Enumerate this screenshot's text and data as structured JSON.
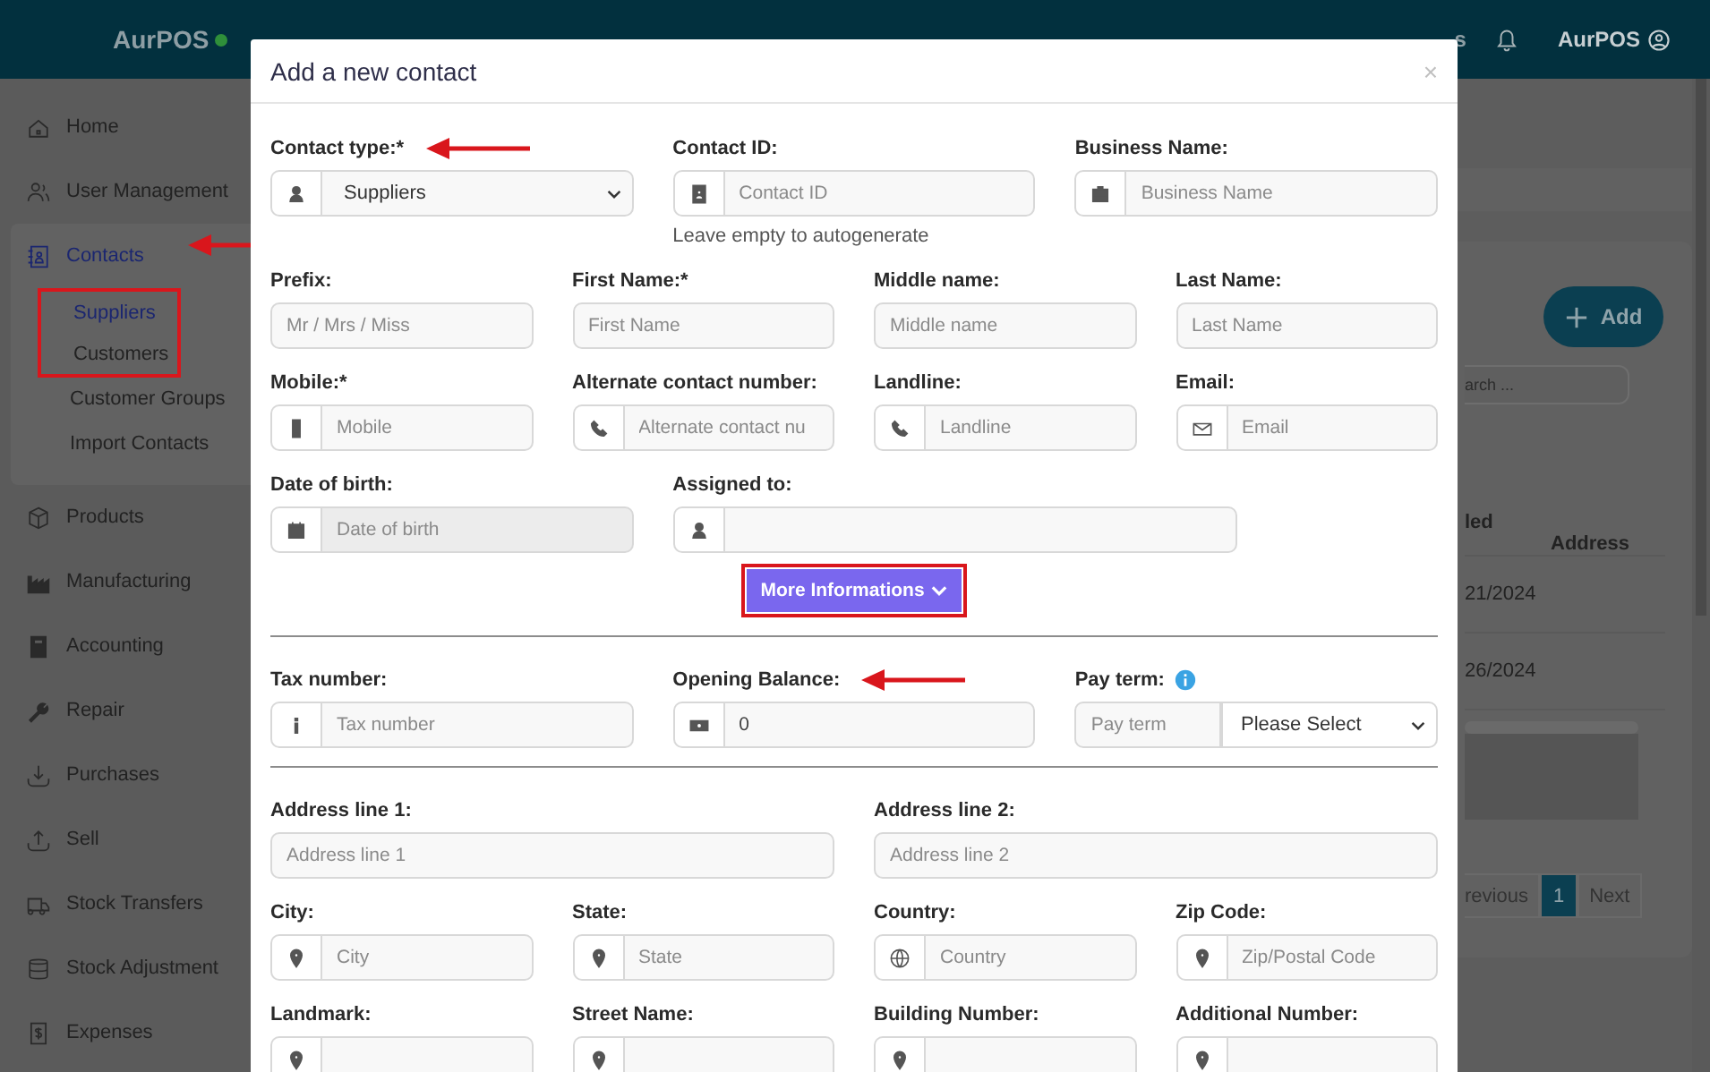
{
  "header": {
    "brand": "AurPOS",
    "fragment": "s",
    "user": "AurPOS"
  },
  "sidebar": {
    "items": [
      {
        "label": "Home",
        "selected": false,
        "annotated": false
      },
      {
        "label": "User Management",
        "selected": false,
        "annotated": false
      },
      {
        "label": "Contacts",
        "selected": true,
        "annotated": true,
        "expanded": true,
        "children": [
          {
            "label": "Suppliers",
            "selected": true,
            "boxed": true
          },
          {
            "label": "Customers",
            "selected": false,
            "boxed": true
          },
          {
            "label": "Customer Groups",
            "selected": false,
            "boxed": false
          },
          {
            "label": "Import Contacts",
            "selected": false,
            "boxed": false
          }
        ]
      },
      {
        "label": "Products",
        "selected": false,
        "annotated": false
      },
      {
        "label": "Manufacturing",
        "selected": false,
        "annotated": false
      },
      {
        "label": "Accounting",
        "selected": false,
        "annotated": false
      },
      {
        "label": "Repair",
        "selected": false,
        "annotated": false
      },
      {
        "label": "Purchases",
        "selected": false,
        "annotated": false
      },
      {
        "label": "Sell",
        "selected": false,
        "annotated": false
      },
      {
        "label": "Stock Transfers",
        "selected": false,
        "annotated": false
      },
      {
        "label": "Stock Adjustment",
        "selected": false,
        "annotated": false
      },
      {
        "label": "Expenses",
        "selected": false,
        "annotated": false
      }
    ]
  },
  "background_page": {
    "add_button": "Add",
    "search_placeholder": "arch ...",
    "columns": [
      "led",
      "Address"
    ],
    "rows": [
      "21/2024",
      "26/2024"
    ],
    "pagination": [
      {
        "label": "revious",
        "selected": false
      },
      {
        "label": "1",
        "selected": true
      },
      {
        "label": "Next",
        "selected": false
      }
    ]
  },
  "modal": {
    "title": "Add a new contact",
    "close": "×",
    "section_1": [
      {
        "label": "Contact type:*",
        "kind": "select",
        "value": "Suppliers",
        "annotated": true
      },
      {
        "label": "Contact ID:",
        "kind": "text",
        "placeholder": "Contact ID",
        "hint": "Leave empty to autogenerate"
      },
      {
        "label": "Business Name:",
        "kind": "text",
        "placeholder": "Business Name"
      },
      {
        "label": "Prefix:",
        "kind": "text",
        "placeholder": "Mr / Mrs / Miss"
      },
      {
        "label": "First Name:*",
        "kind": "text",
        "placeholder": "First Name"
      },
      {
        "label": "Middle name:",
        "kind": "text",
        "placeholder": "Middle name"
      },
      {
        "label": "Last Name:",
        "kind": "text",
        "placeholder": "Last Name"
      },
      {
        "label": "Mobile:*",
        "kind": "text",
        "placeholder": "Mobile"
      },
      {
        "label": "Alternate contact number:",
        "kind": "text",
        "placeholder": "Alternate contact nu"
      },
      {
        "label": "Landline:",
        "kind": "text",
        "placeholder": "Landline"
      },
      {
        "label": "Email:",
        "kind": "text",
        "placeholder": "Email"
      },
      {
        "label": "Date of birth:",
        "kind": "text",
        "placeholder": "Date of birth",
        "disabled": true
      },
      {
        "label": "Assigned to:",
        "kind": "text"
      }
    ],
    "more_button": {
      "label": "More Informations",
      "boxed": true
    },
    "section_2": [
      {
        "label": "Tax number:",
        "kind": "text",
        "placeholder": "Tax number"
      },
      {
        "label": "Opening Balance:",
        "kind": "text",
        "value": "0",
        "annotated": true
      },
      {
        "label": "Pay term:",
        "kind": "combo",
        "placeholder": "Pay term",
        "value": "Please Select",
        "info": true
      }
    ],
    "section_3": [
      {
        "label": "Address line 1:",
        "kind": "text",
        "placeholder": "Address line 1"
      },
      {
        "label": "Address line 2:",
        "kind": "text",
        "placeholder": "Address line 2"
      },
      {
        "label": "City:",
        "kind": "text",
        "placeholder": "City"
      },
      {
        "label": "State:",
        "kind": "text",
        "placeholder": "State"
      },
      {
        "label": "Country:",
        "kind": "text",
        "placeholder": "Country"
      },
      {
        "label": "Zip Code:",
        "kind": "text",
        "placeholder": "Zip/Postal Code"
      },
      {
        "label": "Landmark:",
        "kind": "text"
      },
      {
        "label": "Street Name:",
        "kind": "text"
      },
      {
        "label": "Building Number:",
        "kind": "text"
      },
      {
        "label": "Additional Number:",
        "kind": "text"
      }
    ]
  }
}
